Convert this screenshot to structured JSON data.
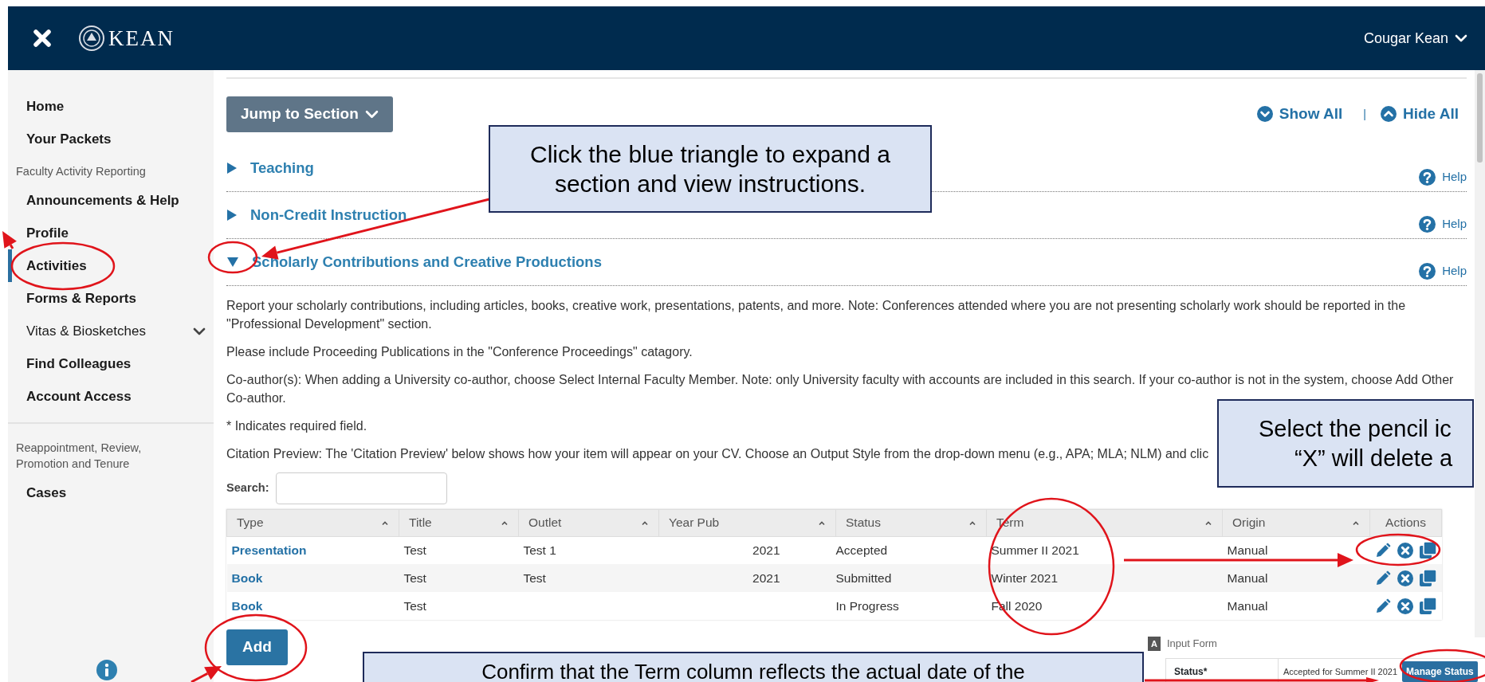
{
  "header": {
    "logo_text": "KEAN",
    "user_menu": "Cougar Kean"
  },
  "sidebar": {
    "items": [
      {
        "label": "Home",
        "kind": "link",
        "selected": false,
        "has_submenu": false,
        "divider_before": false
      },
      {
        "label": "Your Packets",
        "kind": "link",
        "selected": false,
        "has_submenu": false,
        "divider_before": false
      },
      {
        "label": "Faculty Activity Reporting",
        "kind": "heading",
        "divider_before": false
      },
      {
        "label": "Announcements & Help",
        "kind": "link",
        "selected": false,
        "has_submenu": false,
        "divider_before": false
      },
      {
        "label": "Profile",
        "kind": "link",
        "selected": false,
        "has_submenu": false,
        "divider_before": false
      },
      {
        "label": "Activities",
        "kind": "link",
        "selected": true,
        "has_submenu": false,
        "divider_before": false
      },
      {
        "label": "Forms & Reports",
        "kind": "link",
        "selected": false,
        "has_submenu": false,
        "divider_before": false
      },
      {
        "label": "Vitas & Biosketches",
        "kind": "link",
        "selected": false,
        "has_submenu": true,
        "divider_before": false
      },
      {
        "label": "Find Colleagues",
        "kind": "link",
        "selected": false,
        "has_submenu": false,
        "divider_before": false
      },
      {
        "label": "Account Access",
        "kind": "link",
        "selected": false,
        "has_submenu": false,
        "divider_before": false
      },
      {
        "label": "Reappointment, Review, Promotion and Tenure",
        "kind": "heading",
        "divider_before": true
      },
      {
        "label": "Cases",
        "kind": "link",
        "selected": false,
        "has_submenu": false,
        "divider_before": false
      }
    ]
  },
  "toolbar": {
    "jump_button": "Jump to Section",
    "show_all": "Show All",
    "separator": "|",
    "hide_all": "Hide All"
  },
  "sections": [
    {
      "title": "Teaching",
      "expanded": false,
      "help": "Help"
    },
    {
      "title": "Non-Credit Instruction",
      "expanded": false,
      "help": "Help"
    },
    {
      "title": "Scholarly Contributions and Creative Productions",
      "expanded": true,
      "help": "Help",
      "content": {
        "paragraphs": [
          "Report your scholarly contributions, including articles, books, creative work, presentations, patents, and more. Note: Conferences attended where you are not presenting scholarly work should be reported in the \"Professional Development\" section.",
          "Please include Proceeding Publications in the \"Conference Proceedings\" catagory.",
          "Co-author(s): When adding a University co-author, choose Select Internal Faculty Member. Note: only University faculty with accounts are included in this search. If your co-author is not in the system, choose Add Other Co-author.",
          "* Indicates required field.",
          "Citation Preview: The 'Citation Preview' below shows how your item will appear on your CV. Choose an Output Style from the drop-down menu (e.g., APA; MLA; NLM) and clic"
        ],
        "search_label": "Search:",
        "table": {
          "columns": [
            {
              "label": "Type",
              "sortable": true
            },
            {
              "label": "Title",
              "sortable": true
            },
            {
              "label": "Outlet",
              "sortable": true
            },
            {
              "label": "Year Pub",
              "sortable": true
            },
            {
              "label": "Status",
              "sortable": true
            },
            {
              "label": "Term",
              "sortable": true
            },
            {
              "label": "Origin",
              "sortable": true
            },
            {
              "label": "Actions",
              "sortable": false
            }
          ],
          "rows": [
            {
              "type": "Presentation",
              "title": "Test",
              "outlet": "Test 1",
              "year_pub": "2021",
              "status": "Accepted",
              "term": "Summer II 2021",
              "origin": "Manual"
            },
            {
              "type": "Book",
              "title": "Test",
              "outlet": "Test",
              "year_pub": "2021",
              "status": "Submitted",
              "term": "Winter 2021",
              "origin": "Manual"
            },
            {
              "type": "Book",
              "title": "Test",
              "status": "In Progress",
              "term": "Fall 2020",
              "origin": "Manual"
            }
          ]
        },
        "add_button": "Add"
      }
    }
  ],
  "input_form": {
    "badge": "A",
    "title": "Input Form",
    "label": "Status*",
    "value": "Accepted for Summer II 2021",
    "button": "Manage Status"
  },
  "callouts": [
    {
      "lines": [
        "Click the blue triangle to expand a",
        "section and view instructions."
      ]
    },
    {
      "lines": [
        "Select the pencil ic",
        "“X” will delete a"
      ]
    },
    {
      "lines": [
        "Confirm that the Term column reflects the actual date of the"
      ]
    }
  ]
}
